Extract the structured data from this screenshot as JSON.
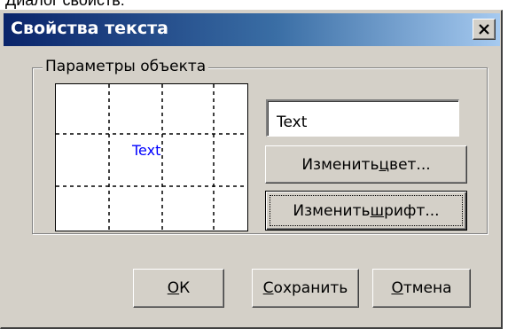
{
  "window": {
    "top_caption": "Диалог свойств:",
    "title": "Свойства текста",
    "close_glyph": "✕"
  },
  "group": {
    "label": "Параметры объекта",
    "preview_text": "Text",
    "preview_text_color": "#0000ff"
  },
  "text_field": {
    "value": "Text"
  },
  "buttons": {
    "change_color": {
      "before": "Изменить ",
      "mnemonic": "ц",
      "after": "вет..."
    },
    "change_font": {
      "before": "Изменить ",
      "mnemonic": "ш",
      "after": "рифт..."
    },
    "ok": {
      "before": "",
      "mnemonic": "О",
      "after": "К"
    },
    "save": {
      "before": "",
      "mnemonic": "С",
      "after": "охранить"
    },
    "cancel": {
      "before": "",
      "mnemonic": "О",
      "after": "тмена"
    }
  },
  "colors": {
    "dialog_bg": "#d4d0c8",
    "title_start": "#0a246a",
    "title_end": "#a6caf0"
  }
}
